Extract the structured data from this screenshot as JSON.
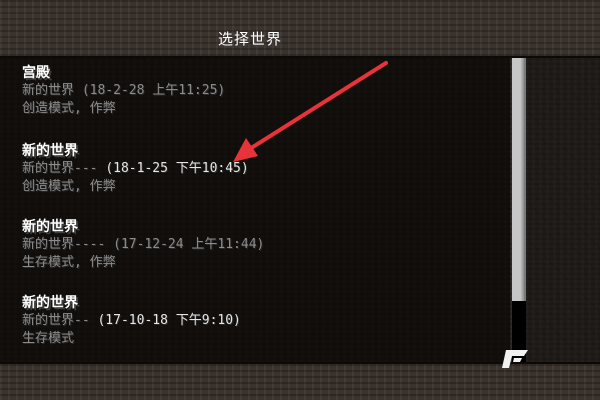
{
  "screen": {
    "title": "选择世界"
  },
  "worlds": [
    {
      "name": "宫殿",
      "info": "新的世界 (18-2-28 上午11:25)",
      "mode": "创造模式, 作弊"
    },
    {
      "name": "新的世界",
      "info_label": "新的世界---",
      "info_date": "(18-1-25 下午10:45)",
      "mode": "创造模式, 作弊"
    },
    {
      "name": "新的世界",
      "info": "新的世界---- (17-12-24 上午11:44)",
      "mode": "生存模式, 作弊"
    },
    {
      "name": "新的世界",
      "info_label": "新的世界--",
      "info_date": "(17-10-18 下午9:10)",
      "mode": "生存模式"
    }
  ],
  "annotation": {
    "arrow_color": "#e8333a",
    "points_to": "world-2-date"
  },
  "colors": {
    "title_text": "#ffffff",
    "name_text": "#ffffff",
    "info_text": "#8c8c8c",
    "scrollbar_thumb": "#c6c6c6"
  },
  "icons": {
    "corner": "mojang-logo-icon"
  },
  "scroll": {
    "position_fraction": 0.0,
    "visible_fraction": 0.8
  }
}
